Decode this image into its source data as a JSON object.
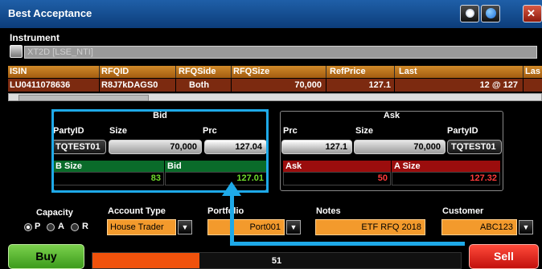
{
  "window": {
    "title": "Best Acceptance"
  },
  "instrument": {
    "label": "Instrument",
    "value": "XT2D [LSE_NTI]"
  },
  "grid": {
    "headers": [
      "ISIN",
      "RFQID",
      "RFQSide",
      "RFQSize",
      "RefPrice",
      "Last",
      "Las"
    ],
    "row": [
      "LU0411078636",
      "R8J7kDAGS0",
      "Both",
      "70,000",
      "127.1",
      "12 @ 127",
      ""
    ]
  },
  "bid": {
    "title": "Bid",
    "party_label": "PartyID",
    "size_label": "Size",
    "prc_label": "Prc",
    "party_id": "TQTEST01",
    "size": "70,000",
    "prc": "127.04",
    "bsize_label": "B Size",
    "bid_label": "Bid",
    "bsize_value": "83",
    "bid_value": "127.01"
  },
  "ask": {
    "title": "Ask",
    "prc_label": "Prc",
    "size_label": "Size",
    "party_label": "PartyID",
    "prc": "127.1",
    "size": "70,000",
    "party_id": "TQTEST01",
    "ask_label": "Ask",
    "asize_label": "A Size",
    "ask_value": "50",
    "asize_value": "127.32"
  },
  "capacity": {
    "label": "Capacity",
    "options": [
      "P",
      "A",
      "R"
    ],
    "selected": "P"
  },
  "account_type": {
    "label": "Account Type",
    "value": "House Trader"
  },
  "portfolio": {
    "label": "Portfolio",
    "value": "Port001"
  },
  "notes": {
    "label": "Notes",
    "value": "ETF RFQ 2018"
  },
  "customer": {
    "label": "Customer",
    "value": "ABC123"
  },
  "actions": {
    "buy": "Buy",
    "sell": "Sell"
  },
  "countdown": {
    "value": "51",
    "progress_fraction": 0.29
  },
  "colors": {
    "accent_highlight": "#1ea9e8",
    "bid_green": "#0a6b2a",
    "ask_red": "#9b0d0d",
    "buy": "#4caf2a",
    "sell": "#e0221a"
  },
  "icons": [
    "help-icon",
    "globe-icon",
    "close-icon",
    "dropdown-arrow-icon"
  ]
}
